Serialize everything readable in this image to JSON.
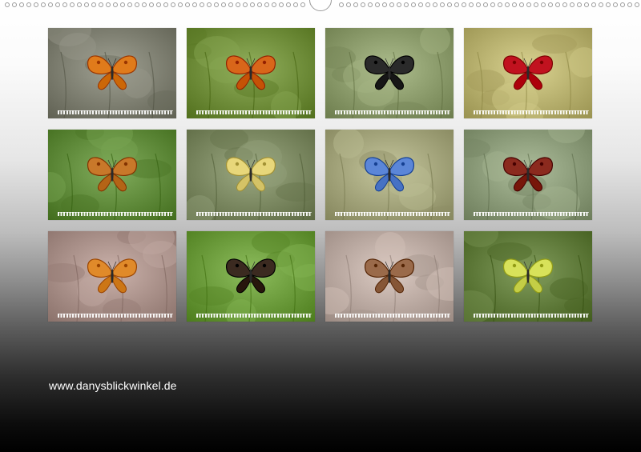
{
  "website": "www.danysblickwinkel.de",
  "months": [
    {
      "name": "",
      "subject": "small-copper-butterfly-icon",
      "bg": "#7d7e70",
      "accent": "#e07b1b"
    },
    {
      "name": "",
      "subject": "small-tortoiseshell-butterfly-icon",
      "bg": "#6f8d3a",
      "accent": "#d9661a"
    },
    {
      "name": "",
      "subject": "map-butterfly-icon",
      "bg": "#8a9a6a",
      "accent": "#2a2a2a"
    },
    {
      "name": "",
      "subject": "burnet-moth-icon",
      "bg": "#b7b06e",
      "accent": "#c1121f"
    },
    {
      "name": "",
      "subject": "meadow-brown-butterfly-icon",
      "bg": "#5f8a3a",
      "accent": "#c8782a"
    },
    {
      "name": "",
      "subject": "swallowtail-butterfly-icon",
      "bg": "#7a8760",
      "accent": "#e8d77a"
    },
    {
      "name": "",
      "subject": "common-blue-butterfly-icon",
      "bg": "#a2a37a",
      "accent": "#5b86d8"
    },
    {
      "name": "",
      "subject": "peacock-butterfly-icon",
      "bg": "#8a9a78",
      "accent": "#8b2a1e"
    },
    {
      "name": "",
      "subject": "painted-lady-butterfly-icon",
      "bg": "#a88f88",
      "accent": "#e08a2a"
    },
    {
      "name": "",
      "subject": "red-admiral-butterfly-icon",
      "bg": "#6a9a3a",
      "accent": "#3b2a20"
    },
    {
      "name": "",
      "subject": "emperor-moth-icon",
      "bg": "#b9a8a0",
      "accent": "#9a6a4a"
    },
    {
      "name": "",
      "subject": "brimstone-butterfly-icon",
      "bg": "#5f7a3a",
      "accent": "#d8e25a"
    }
  ]
}
